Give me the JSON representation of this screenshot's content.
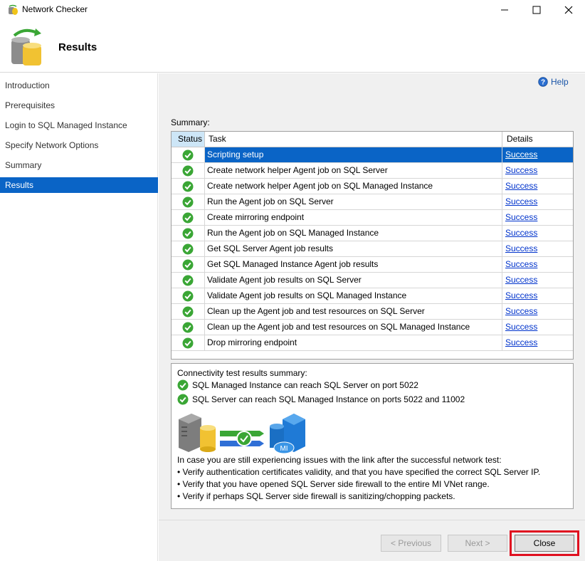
{
  "window": {
    "title": "Network Checker"
  },
  "header": {
    "page_title": "Results"
  },
  "sidebar": {
    "items": [
      {
        "label": "Introduction",
        "active": false
      },
      {
        "label": "Prerequisites",
        "active": false
      },
      {
        "label": "Login to SQL Managed Instance",
        "active": false
      },
      {
        "label": "Specify Network Options",
        "active": false
      },
      {
        "label": "Summary",
        "active": false
      },
      {
        "label": "Results",
        "active": true
      }
    ]
  },
  "main": {
    "help_label": "Help",
    "summary_label": "Summary:",
    "grid": {
      "columns": [
        "Status",
        "Task",
        "Details"
      ],
      "rows": [
        {
          "task": "Scripting setup",
          "details": "Success",
          "selected": true
        },
        {
          "task": "Create network helper Agent job on SQL Server",
          "details": "Success"
        },
        {
          "task": "Create network helper Agent job on SQL Managed Instance",
          "details": "Success"
        },
        {
          "task": "Run the Agent job on SQL Server",
          "details": "Success"
        },
        {
          "task": "Create mirroring endpoint",
          "details": "Success"
        },
        {
          "task": "Run the Agent job on SQL Managed Instance",
          "details": "Success"
        },
        {
          "task": "Get SQL Server Agent job results",
          "details": "Success"
        },
        {
          "task": "Get SQL Managed Instance Agent job results",
          "details": "Success"
        },
        {
          "task": "Validate Agent job results on SQL Server",
          "details": "Success"
        },
        {
          "task": "Validate Agent job results on SQL Managed Instance",
          "details": "Success"
        },
        {
          "task": "Clean up the Agent job and test resources on SQL Server",
          "details": "Success"
        },
        {
          "task": "Clean up the Agent job and test resources on SQL Managed Instance",
          "details": "Success"
        },
        {
          "task": "Drop mirroring endpoint",
          "details": "Success"
        }
      ]
    },
    "connectivity": {
      "title": "Connectivity test results summary:",
      "results": [
        "SQL Managed Instance can reach SQL Server on port 5022",
        "SQL Server can reach SQL Managed Instance on ports 5022 and 11002"
      ],
      "mi_badge": "MI",
      "advice_intro": "In case you are still experiencing issues with the link after the successful network test:",
      "advice_items": [
        "• Verify authentication certificates validity, and that you have specified the correct SQL Server IP.",
        "• Verify that you have opened SQL Server side firewall to the entire MI VNet range.",
        "• Verify if perhaps SQL Server side firewall is sanitizing/chopping packets."
      ]
    }
  },
  "footer": {
    "previous_label": "< Previous",
    "next_label": "Next >",
    "close_label": "Close"
  },
  "colors": {
    "accent": "#0a64c6",
    "highlight": "#e01020",
    "success": "#3aa635"
  },
  "icons": {
    "title": "database-sync-icon",
    "header": "database-sync-icon",
    "help": "help-icon",
    "status": "check-circle-icon"
  }
}
